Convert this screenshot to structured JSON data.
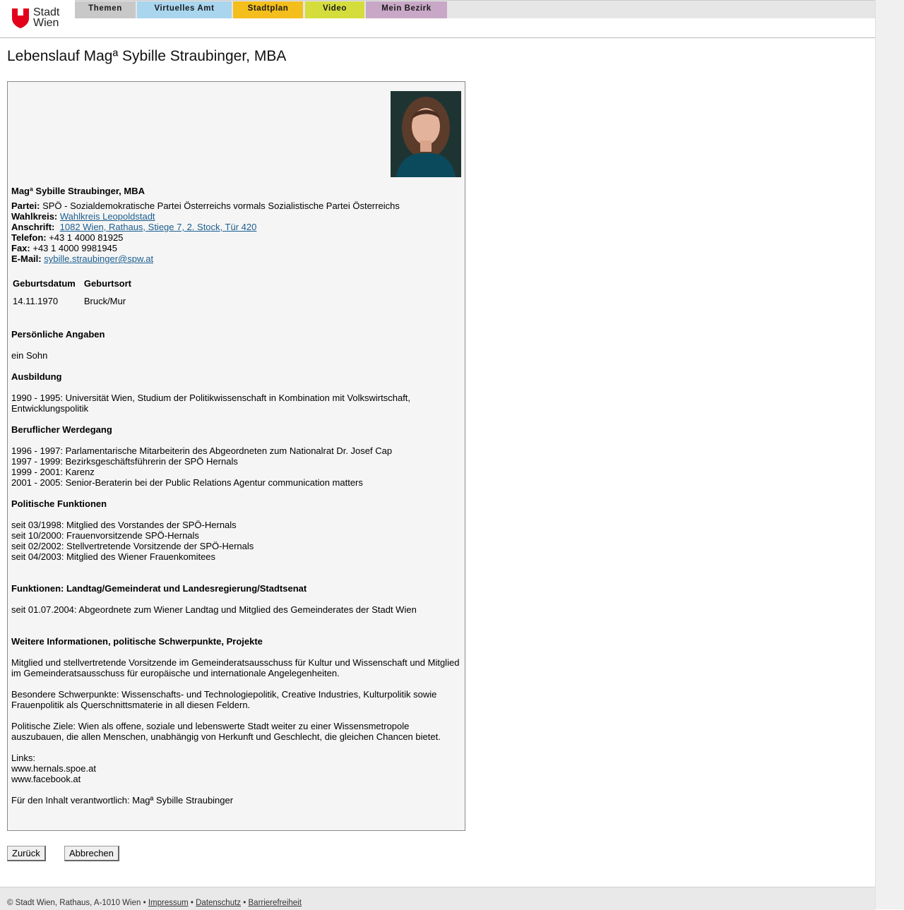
{
  "logo": {
    "line1": "Stadt",
    "line2": "Wien"
  },
  "nav": {
    "tabs": [
      {
        "label": "Themen",
        "color": "#c8c8c8"
      },
      {
        "label": "Virtuelles Amt",
        "color": "#a9d5ef"
      },
      {
        "label": "Stadtplan",
        "color": "#f4be1c"
      },
      {
        "label": "Video",
        "color": "#d4dd3c"
      },
      {
        "label": "Mein Bezirk",
        "color": "#c8a8c6"
      }
    ]
  },
  "page_title": "Lebenslauf Magª Sybille Straubinger, MBA",
  "profile": {
    "name": "Magª Sybille Straubinger, MBA",
    "partei_label": "Partei:",
    "partei": "SPÖ - Sozialdemokratische Partei Österreichs vormals Sozialistische Partei Österreichs",
    "wahlkreis_label": "Wahlkreis:",
    "wahlkreis": "Wahlkreis Leopoldstadt",
    "anschrift_label": "Anschrift:",
    "anschrift": "1082 Wien, Rathaus, Stiege 7, 2. Stock, Tür 420",
    "telefon_label": "Telefon:",
    "telefon": "+43 1 4000 81925",
    "fax_label": "Fax:",
    "fax": "+43 1 4000 9981945",
    "email_label": "E-Mail:",
    "email": "sybille.straubinger@spw.at"
  },
  "birth": {
    "col1": "Geburtsdatum",
    "col2": "Geburtsort",
    "date": "14.11.1970",
    "place": "Bruck/Mur"
  },
  "sections": {
    "persoenlich_title": "Persönliche Angaben",
    "persoenlich": [
      "ein Sohn"
    ],
    "ausbildung_title": "Ausbildung",
    "ausbildung": [
      "1990 - 1995: Universität Wien, Studium der Politikwissenschaft in Kombination mit Volkswirtschaft, Entwicklungspolitik"
    ],
    "beruf_title": "Beruflicher Werdegang",
    "beruf": [
      "1996 - 1997: Parlamentarische Mitarbeiterin des Abgeordneten zum Nationalrat Dr. Josef Cap",
      "1997 - 1999: Bezirksgeschäftsführerin der SPÖ Hernals",
      "1999 - 2001: Karenz",
      "2001 - 2005: Senior-Beraterin bei der Public Relations Agentur communication matters"
    ],
    "politisch_title": "Politische Funktionen",
    "politisch": [
      "seit 03/1998: Mitglied des Vorstandes der SPÖ-Hernals",
      "seit 10/2000: Frauenvorsitzende SPÖ-Hernals",
      "seit 02/2002: Stellvertretende Vorsitzende der SPÖ-Hernals",
      "seit 04/2003: Mitglied des Wiener Frauenkomitees"
    ],
    "landtag_title": "Funktionen: Landtag/Gemeinderat und Landesregierung/Stadtsenat",
    "landtag": [
      "seit 01.07.2004: Abgeordnete zum Wiener Landtag und Mitglied des Gemeinderates der Stadt Wien"
    ],
    "weitere_title": "Weitere Informationen, politische Schwerpunkte, Projekte",
    "weitere_p1": "Mitglied und stellvertretende Vorsitzende im Gemeinderatsausschuss für Kultur und Wissenschaft und Mitglied im Gemeinderatsausschuss für europäische und internationale Angelegenheiten.",
    "weitere_p2": "Besondere Schwerpunkte: Wissenschafts- und Technologiepolitik, Creative Industries, Kulturpolitik sowie Frauenpolitik als Querschnittsmaterie in all diesen Feldern.",
    "weitere_p3": "Politische Ziele: Wien als offene, soziale und lebenswerte Stadt weiter zu einer Wissensmetropole auszubauen, die allen Menschen, unabhängig von Herkunft und Geschlecht, die gleichen Chancen bietet.",
    "links_label": "Links:",
    "links": [
      "www.hernals.spoe.at",
      "www.facebook.at"
    ],
    "verantwortlich": "Für den Inhalt verantwortlich: Magª Sybille Straubinger"
  },
  "buttons": {
    "back": "Zurück",
    "cancel": "Abbrechen"
  },
  "footer": {
    "copyright": "© Stadt Wien, Rathaus, A-1010 Wien •",
    "impressum": "Impressum",
    "sep": "•",
    "datenschutz": "Datenschutz",
    "barrierefreiheit": "Barrierefreiheit"
  }
}
